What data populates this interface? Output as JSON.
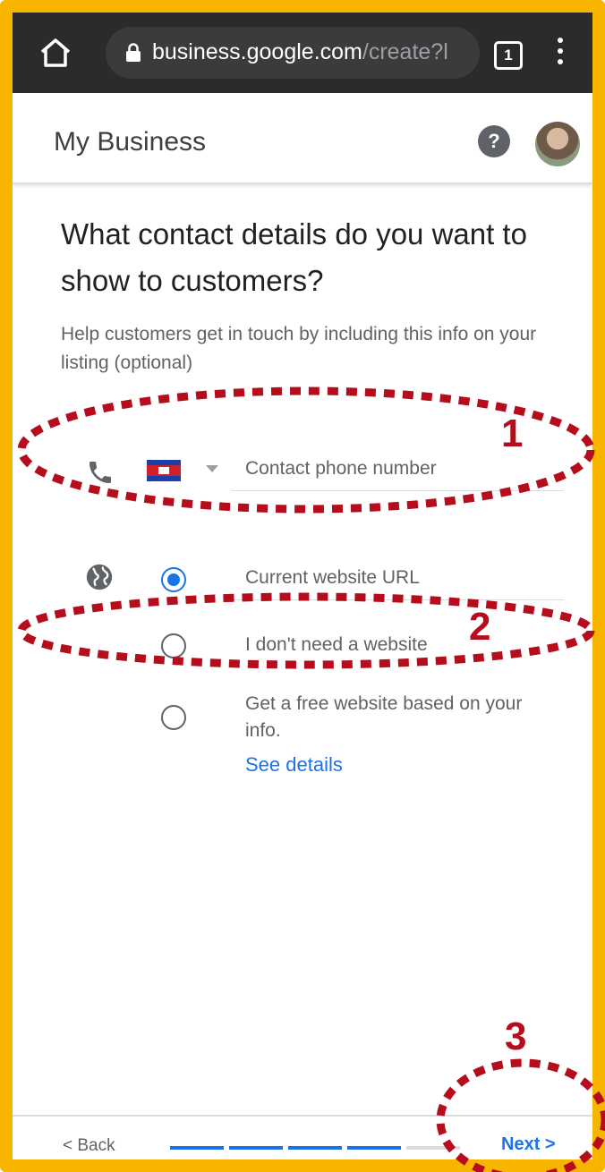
{
  "browser": {
    "url_host": "business.google.com",
    "url_path": "/create?l",
    "tab_count": "1"
  },
  "header": {
    "title": "My Business",
    "help_label": "?"
  },
  "main": {
    "heading": "What contact details do you want to show to customers?",
    "subtext": "Help customers get in touch by including this info on your listing (optional)",
    "phone_placeholder": "Contact phone number",
    "website_placeholder": "Current website URL",
    "option_no_website": "I don't need a website",
    "option_free_website": "Get a free website based on your info.",
    "see_details": "See details",
    "selected_option": "current-website"
  },
  "footer": {
    "back_label": "< Back",
    "next_label": "Next >",
    "progress": {
      "completed_steps": 4,
      "total_steps": 5
    }
  },
  "annotations": {
    "label_1": "1",
    "label_2": "2",
    "label_3": "3"
  },
  "colors": {
    "frame": "#F7B500",
    "accent": "#1a73e8",
    "annotation": "#B50D1B"
  }
}
